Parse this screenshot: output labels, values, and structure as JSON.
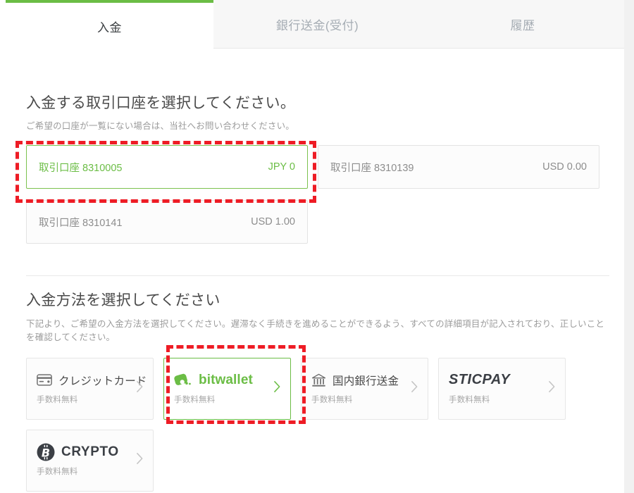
{
  "theme": {
    "accent_green": "#6bbd45",
    "annotation_red": "#ee1c25",
    "text_dark": "#4a4a4a",
    "text_muted": "#9b9b9b",
    "tabstrip_bg": "#f7f7f7"
  },
  "tabs": [
    {
      "label": "入金",
      "active": true
    },
    {
      "label": "銀行送金(受付)",
      "active": false
    },
    {
      "label": "履歴",
      "active": false
    }
  ],
  "accounts_section": {
    "title": "入金する取引口座を選択してください。",
    "subtitle": "ご希望の口座が一覧にない場合は、当社へお問い合わせください。",
    "cards": [
      {
        "label": "取引口座 8310005",
        "balance": "JPY 0",
        "selected": true
      },
      {
        "label": "取引口座 8310139",
        "balance": "USD 0.00",
        "selected": false
      },
      {
        "label": "取引口座 8310141",
        "balance": "USD 1.00",
        "selected": false
      }
    ]
  },
  "methods_section": {
    "title": "入金方法を選択してください",
    "subtitle": "下記より、ご希望の入金方法を選択してください。遅滞なく手続きを進めることができるよう、すべての詳細項目が記入されており、正しいことを確認してください。",
    "cards": [
      {
        "label": "クレジットカード",
        "fee": "手数料無料",
        "icon": "credit-card-icon",
        "highlighted": false
      },
      {
        "label": "bitwallet",
        "fee": "手数料無料",
        "icon": "bitwallet-logo-icon",
        "highlighted": true
      },
      {
        "label": "国内銀行送金",
        "fee": "手数料無料",
        "icon": "bank-icon",
        "highlighted": false
      },
      {
        "label": "STICPAY",
        "fee": "手数料無料",
        "icon": "sticpay-wordmark-icon",
        "highlighted": false
      },
      {
        "label": "CRYPTO",
        "fee": "手数料無料",
        "icon": "bitcoin-icon",
        "highlighted": false
      }
    ],
    "chevron_icon": "chevron-right-icon"
  },
  "annotations": [
    {
      "name": "account-card-highlight",
      "target": "取引口座 8310005"
    },
    {
      "name": "bitwallet-method-highlight",
      "target": "bitwallet"
    }
  ]
}
